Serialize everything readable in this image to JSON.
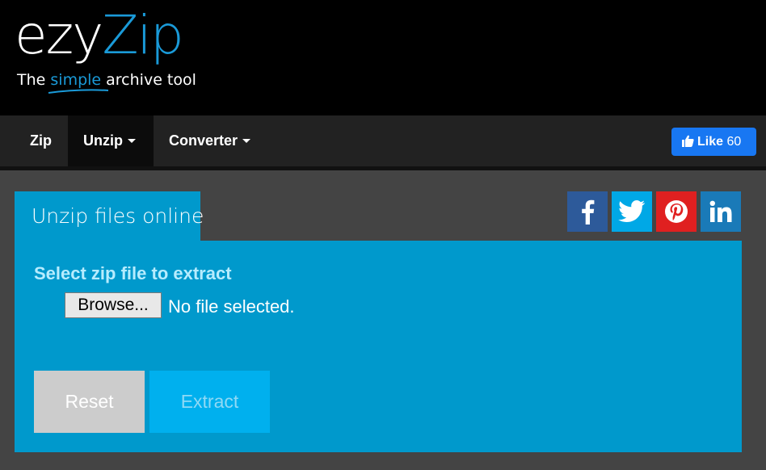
{
  "header": {
    "logo_part1": "ezy",
    "logo_part2": "Zip",
    "tagline_before": "The ",
    "tagline_highlight": "simple",
    "tagline_after": " archive tool"
  },
  "nav": {
    "zip": "Zip",
    "unzip": "Unzip",
    "converter": "Converter",
    "like_label": "Like",
    "like_count": "60"
  },
  "main": {
    "tab_title": "Unzip files online",
    "select_label": "Select zip file to extract",
    "browse_label": "Browse...",
    "file_status": "No file selected.",
    "reset_label": "Reset",
    "extract_label": "Extract"
  },
  "social": [
    "facebook-icon",
    "twitter-icon",
    "pinterest-icon",
    "linkedin-icon"
  ],
  "colors": {
    "brand_blue": "#1a9ad8",
    "panel_blue": "#0099cc",
    "facebook": "#2d5a9a",
    "twitter": "#00a8e6",
    "pinterest": "#e02020",
    "linkedin": "#1a7ab8",
    "like_button": "#1877f2"
  }
}
